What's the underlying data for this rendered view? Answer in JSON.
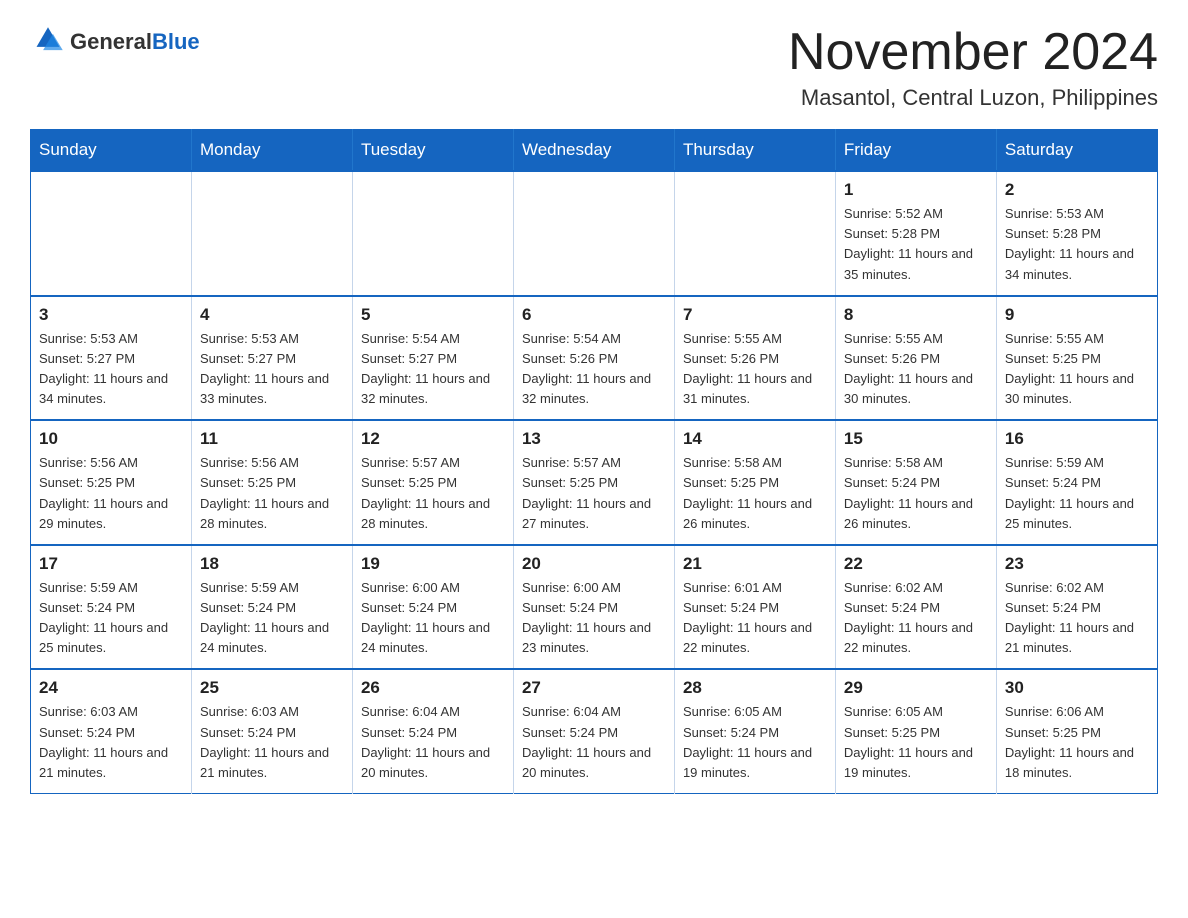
{
  "header": {
    "logo_text_black": "General",
    "logo_text_blue": "Blue",
    "page_title": "November 2024",
    "subtitle": "Masantol, Central Luzon, Philippines"
  },
  "weekdays": [
    "Sunday",
    "Monday",
    "Tuesday",
    "Wednesday",
    "Thursday",
    "Friday",
    "Saturday"
  ],
  "weeks": [
    [
      {
        "day": "",
        "info": ""
      },
      {
        "day": "",
        "info": ""
      },
      {
        "day": "",
        "info": ""
      },
      {
        "day": "",
        "info": ""
      },
      {
        "day": "",
        "info": ""
      },
      {
        "day": "1",
        "info": "Sunrise: 5:52 AM\nSunset: 5:28 PM\nDaylight: 11 hours and 35 minutes."
      },
      {
        "day": "2",
        "info": "Sunrise: 5:53 AM\nSunset: 5:28 PM\nDaylight: 11 hours and 34 minutes."
      }
    ],
    [
      {
        "day": "3",
        "info": "Sunrise: 5:53 AM\nSunset: 5:27 PM\nDaylight: 11 hours and 34 minutes."
      },
      {
        "day": "4",
        "info": "Sunrise: 5:53 AM\nSunset: 5:27 PM\nDaylight: 11 hours and 33 minutes."
      },
      {
        "day": "5",
        "info": "Sunrise: 5:54 AM\nSunset: 5:27 PM\nDaylight: 11 hours and 32 minutes."
      },
      {
        "day": "6",
        "info": "Sunrise: 5:54 AM\nSunset: 5:26 PM\nDaylight: 11 hours and 32 minutes."
      },
      {
        "day": "7",
        "info": "Sunrise: 5:55 AM\nSunset: 5:26 PM\nDaylight: 11 hours and 31 minutes."
      },
      {
        "day": "8",
        "info": "Sunrise: 5:55 AM\nSunset: 5:26 PM\nDaylight: 11 hours and 30 minutes."
      },
      {
        "day": "9",
        "info": "Sunrise: 5:55 AM\nSunset: 5:25 PM\nDaylight: 11 hours and 30 minutes."
      }
    ],
    [
      {
        "day": "10",
        "info": "Sunrise: 5:56 AM\nSunset: 5:25 PM\nDaylight: 11 hours and 29 minutes."
      },
      {
        "day": "11",
        "info": "Sunrise: 5:56 AM\nSunset: 5:25 PM\nDaylight: 11 hours and 28 minutes."
      },
      {
        "day": "12",
        "info": "Sunrise: 5:57 AM\nSunset: 5:25 PM\nDaylight: 11 hours and 28 minutes."
      },
      {
        "day": "13",
        "info": "Sunrise: 5:57 AM\nSunset: 5:25 PM\nDaylight: 11 hours and 27 minutes."
      },
      {
        "day": "14",
        "info": "Sunrise: 5:58 AM\nSunset: 5:25 PM\nDaylight: 11 hours and 26 minutes."
      },
      {
        "day": "15",
        "info": "Sunrise: 5:58 AM\nSunset: 5:24 PM\nDaylight: 11 hours and 26 minutes."
      },
      {
        "day": "16",
        "info": "Sunrise: 5:59 AM\nSunset: 5:24 PM\nDaylight: 11 hours and 25 minutes."
      }
    ],
    [
      {
        "day": "17",
        "info": "Sunrise: 5:59 AM\nSunset: 5:24 PM\nDaylight: 11 hours and 25 minutes."
      },
      {
        "day": "18",
        "info": "Sunrise: 5:59 AM\nSunset: 5:24 PM\nDaylight: 11 hours and 24 minutes."
      },
      {
        "day": "19",
        "info": "Sunrise: 6:00 AM\nSunset: 5:24 PM\nDaylight: 11 hours and 24 minutes."
      },
      {
        "day": "20",
        "info": "Sunrise: 6:00 AM\nSunset: 5:24 PM\nDaylight: 11 hours and 23 minutes."
      },
      {
        "day": "21",
        "info": "Sunrise: 6:01 AM\nSunset: 5:24 PM\nDaylight: 11 hours and 22 minutes."
      },
      {
        "day": "22",
        "info": "Sunrise: 6:02 AM\nSunset: 5:24 PM\nDaylight: 11 hours and 22 minutes."
      },
      {
        "day": "23",
        "info": "Sunrise: 6:02 AM\nSunset: 5:24 PM\nDaylight: 11 hours and 21 minutes."
      }
    ],
    [
      {
        "day": "24",
        "info": "Sunrise: 6:03 AM\nSunset: 5:24 PM\nDaylight: 11 hours and 21 minutes."
      },
      {
        "day": "25",
        "info": "Sunrise: 6:03 AM\nSunset: 5:24 PM\nDaylight: 11 hours and 21 minutes."
      },
      {
        "day": "26",
        "info": "Sunrise: 6:04 AM\nSunset: 5:24 PM\nDaylight: 11 hours and 20 minutes."
      },
      {
        "day": "27",
        "info": "Sunrise: 6:04 AM\nSunset: 5:24 PM\nDaylight: 11 hours and 20 minutes."
      },
      {
        "day": "28",
        "info": "Sunrise: 6:05 AM\nSunset: 5:24 PM\nDaylight: 11 hours and 19 minutes."
      },
      {
        "day": "29",
        "info": "Sunrise: 6:05 AM\nSunset: 5:25 PM\nDaylight: 11 hours and 19 minutes."
      },
      {
        "day": "30",
        "info": "Sunrise: 6:06 AM\nSunset: 5:25 PM\nDaylight: 11 hours and 18 minutes."
      }
    ]
  ]
}
